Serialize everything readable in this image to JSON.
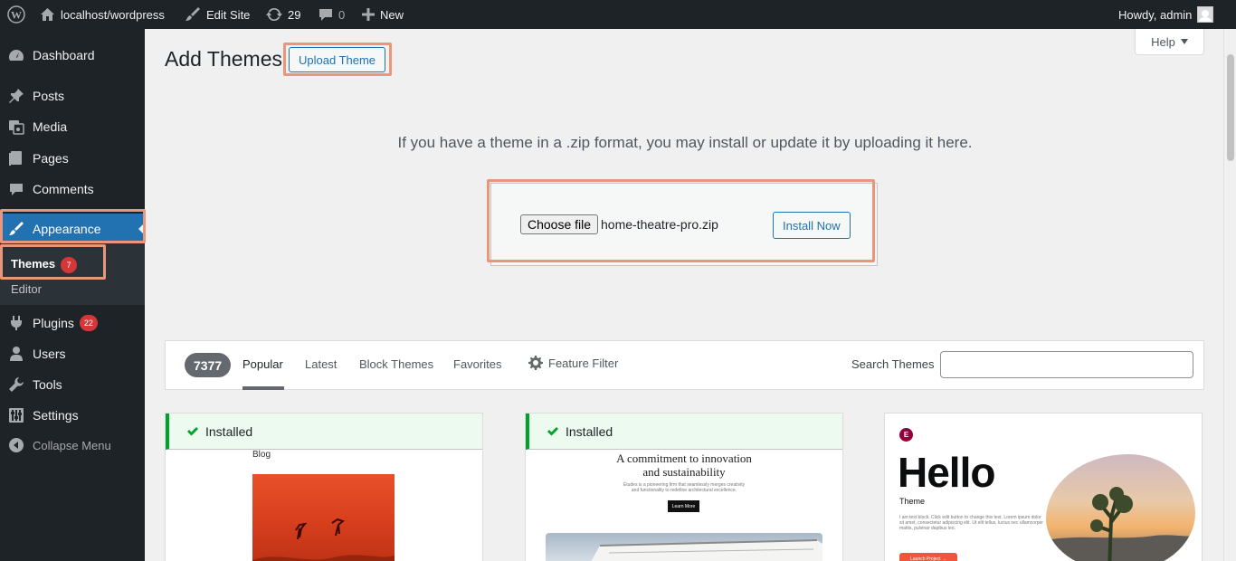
{
  "adminbar": {
    "site_name": "localhost/wordpress",
    "edit_site": "Edit Site",
    "updates_count": "29",
    "comments_count": "0",
    "new_label": "New",
    "howdy": "Howdy, admin"
  },
  "sidebar": {
    "items": [
      {
        "label": "Dashboard",
        "icon": "dashboard-icon"
      },
      {
        "label": "Posts",
        "icon": "pin-icon"
      },
      {
        "label": "Media",
        "icon": "media-icon"
      },
      {
        "label": "Pages",
        "icon": "pages-icon"
      },
      {
        "label": "Comments",
        "icon": "comment-icon"
      },
      {
        "label": "Appearance",
        "icon": "brush-icon"
      },
      {
        "label": "Plugins",
        "icon": "plugin-icon",
        "badge": "22"
      },
      {
        "label": "Users",
        "icon": "user-icon"
      },
      {
        "label": "Tools",
        "icon": "wrench-icon"
      },
      {
        "label": "Settings",
        "icon": "sliders-icon"
      }
    ],
    "submenu": {
      "themes": "Themes",
      "themes_badge": "7",
      "editor": "Editor"
    },
    "collapse": "Collapse Menu"
  },
  "header": {
    "title": "Add Themes",
    "upload_button": "Upload Theme",
    "help": "Help"
  },
  "upload": {
    "intro": "If you have a theme in a .zip format, you may install or update it by uploading it here.",
    "choose_file": "Choose file",
    "file_name": "home-theatre-pro.zip",
    "install_now": "Install Now"
  },
  "filter": {
    "count": "7377",
    "tabs": [
      "Popular",
      "Latest",
      "Block Themes",
      "Favorites"
    ],
    "feature_filter": "Feature Filter",
    "search_label": "Search Themes",
    "search_value": ""
  },
  "themes": [
    {
      "installed": "Installed",
      "preview_label": "Blog"
    },
    {
      "installed": "Installed",
      "preview_title_1": "A commitment to innovation",
      "preview_title_2": "and sustainability",
      "preview_text": "Études is a pioneering firm that seamlessly merges creativity and functionality to redefine architectural excellence.",
      "preview_button": "Learn More"
    },
    {
      "logo": "E",
      "title": "Hello",
      "subtitle": "Theme",
      "text": "I am text block. Click edit button to change this text. Lorem ipsum dolor sit amet, consectetur adipiscing elit. Ut elit tellus, luctus nec ullamcorper mattis, pulvinar dapibus leo.",
      "button": "Launch Project →"
    }
  ],
  "colors": {
    "admin_dark": "#1d2327",
    "accent": "#2271b1",
    "badge": "#d63638",
    "installed_green": "#00a32a",
    "highlight": "#e9967a"
  }
}
